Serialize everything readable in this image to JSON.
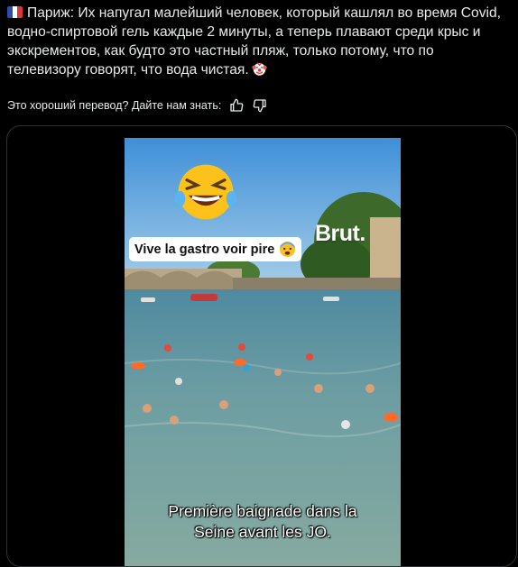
{
  "post": {
    "text": "Париж: Их напугал малейший человек, который кашлял во время Covid, водно-спиртовой гель каждые 2 минуты, а теперь плавают среди крыс и экскрементов, как будто это частный пляж, только потому, что по телевизору говорят, что вода чистая.",
    "flag_icon": "flag-france",
    "end_emoji": "clown-face"
  },
  "translation": {
    "prompt": "Это хороший перевод? Дайте нам знать:",
    "thumbs_up_icon": "thumbs-up-icon",
    "thumbs_down_icon": "thumbs-down-icon"
  },
  "video": {
    "top_caption": "Vive la gastro voir pire",
    "brand": "Brut.",
    "subtitle_line1": "Première baignade dans la",
    "subtitle_line2": "Seine avant les JO."
  },
  "colors": {
    "background": "#000000",
    "text": "#e7e9ea",
    "border": "#2f3336"
  }
}
